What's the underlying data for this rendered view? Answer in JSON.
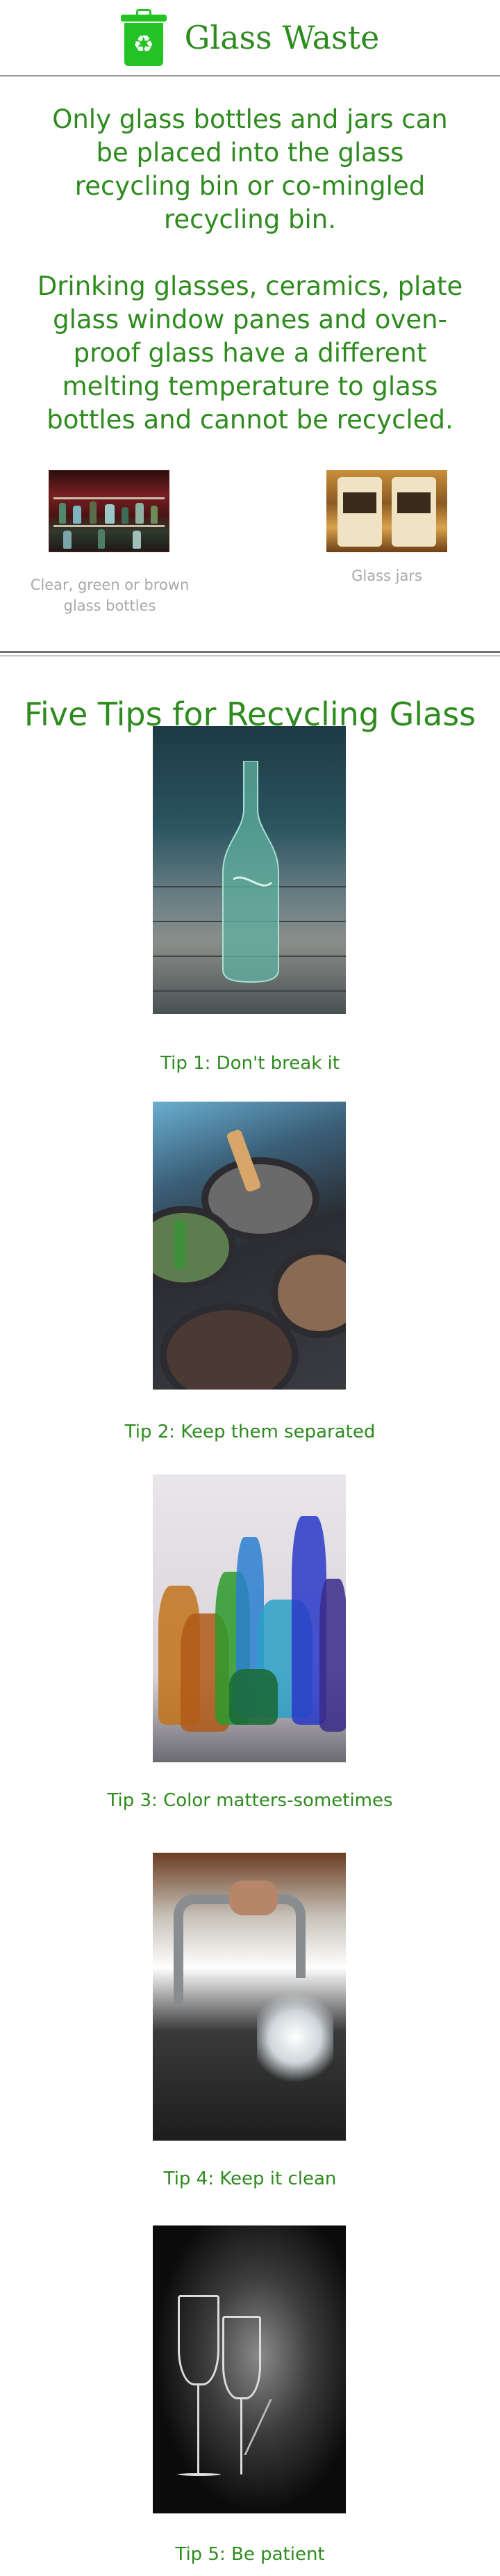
{
  "header": {
    "title": "Glass Waste",
    "icon": "recycle-bin-icon",
    "icon_color": "#22c322"
  },
  "intro": {
    "paragraph1": "Only glass bottles and jars can be placed into the glass recycling bin or co-mingled recycling bin.",
    "paragraph2": "Drinking glasses, ceramics, plate glass window panes and oven-proof glass have a different melting temperature to glass bottles and cannot be recycled."
  },
  "gallery": [
    {
      "caption": "Clear, green or brown glass bottles"
    },
    {
      "caption": "Glass jars"
    }
  ],
  "tips_heading": "Five Tips for Recycling Glass",
  "tips": [
    {
      "caption": "Tip 1: Don't break it"
    },
    {
      "caption": "Tip 2: Keep them separated"
    },
    {
      "caption": "Tip 3: Color matters-sometimes"
    },
    {
      "caption": "Tip 4: Keep it clean"
    },
    {
      "caption": "Tip 5: Be patient"
    }
  ],
  "colors": {
    "accent_green": "#2e8b1e",
    "caption_gray": "#a8a8a8"
  }
}
